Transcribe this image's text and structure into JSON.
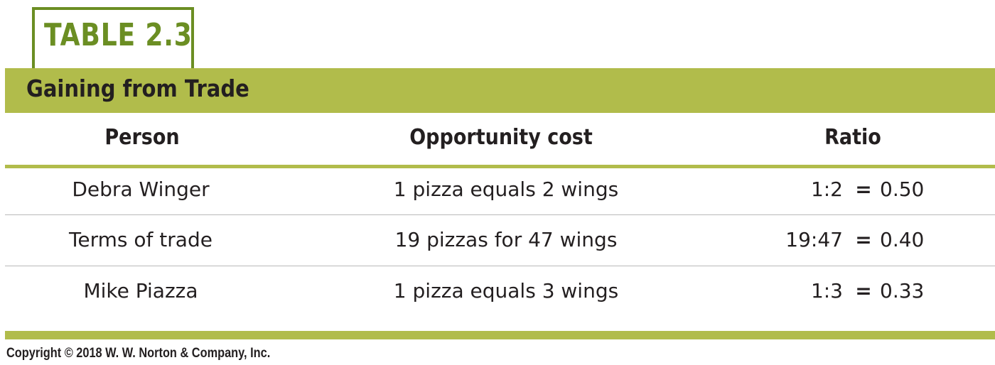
{
  "table_label": "TABLE 2.3",
  "table_title": "Gaining from Trade",
  "columns": {
    "person": "Person",
    "opportunity_cost": "Opportunity cost",
    "ratio": "Ratio"
  },
  "rows": [
    {
      "person": "Debra Winger",
      "opportunity_cost": "1 pizza equals 2 wings",
      "ratio": "1:2",
      "equals": "=",
      "value": "0.50"
    },
    {
      "person": "Terms of trade",
      "opportunity_cost": "19 pizzas for 47 wings",
      "ratio": "19:47",
      "equals": "=",
      "value": "0.40"
    },
    {
      "person": "Mike Piazza",
      "opportunity_cost": "1 pizza equals 3 wings",
      "ratio": "1:3",
      "equals": "=",
      "value": "0.33"
    }
  ],
  "copyright": "Copyright © 2018 W. W. Norton & Company, Inc.",
  "colors": {
    "accent_green": "#b1bc4b",
    "label_green": "#6b8e23",
    "text": "#231f20",
    "rule_gray": "#b9b9b9"
  }
}
